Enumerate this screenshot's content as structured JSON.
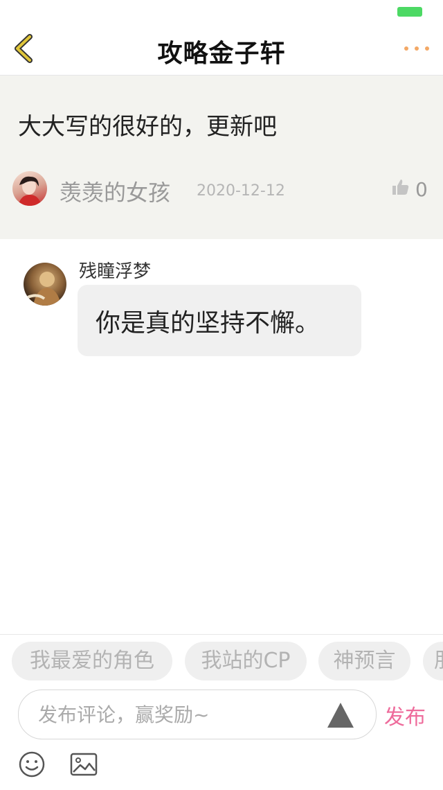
{
  "nav": {
    "title": "攻略金子轩"
  },
  "original_comment": {
    "text": "大大写的很好的，更新吧",
    "user": "羡羡的女孩",
    "date": "2020-12-12",
    "likes": "0"
  },
  "replies": [
    {
      "user": "残瞳浮梦",
      "text": "你是真的坚持不懈。"
    }
  ],
  "quick_tags": [
    "我最爱的角色",
    "我站的CP",
    "神预言",
    "朋"
  ],
  "composer": {
    "placeholder": "发布评论，赢奖励~",
    "send_label": "发布"
  },
  "colors": {
    "accent": "#ee6b9b",
    "back_icon": "#e0c63a",
    "more_dots": "#f3a866",
    "battery": "#4cd964"
  },
  "icons": {
    "back": "chevron-left-icon",
    "more": "ellipsis-icon",
    "like": "thumbs-up-icon",
    "emoji": "emoji-icon",
    "image": "image-icon",
    "input_action": "triangle-icon"
  }
}
